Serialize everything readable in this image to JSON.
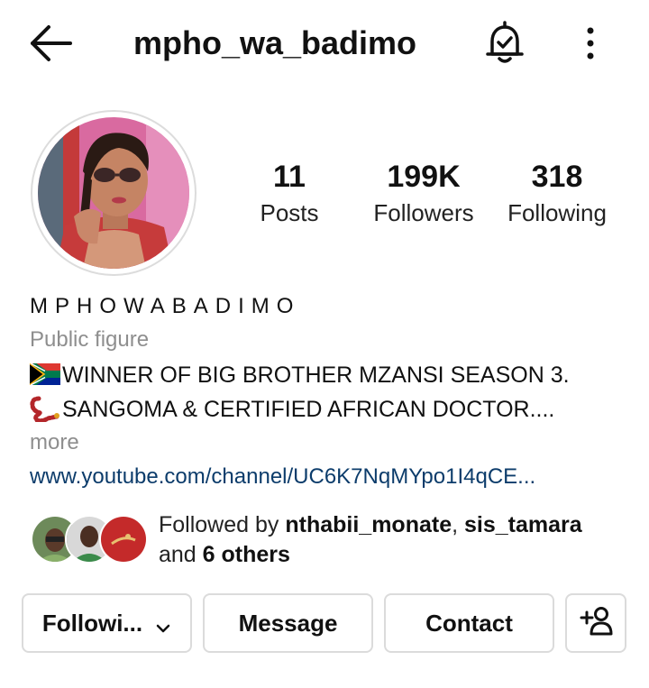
{
  "header": {
    "username": "mpho_wa_badimo",
    "icons": [
      "back-arrow-icon",
      "notification-bell-check-icon",
      "more-vertical-icon"
    ]
  },
  "profile": {
    "avatar_icon": "profile-photo",
    "stats": [
      {
        "value": "11",
        "label": "Posts"
      },
      {
        "value": "199K",
        "label": "Followers"
      },
      {
        "value": "318",
        "label": "Following"
      }
    ],
    "display_name": "MPHOWABADIMO",
    "category": "Public figure",
    "bio_line1": "WINNER OF BIG BROTHER MZANSI SEASON 3.",
    "bio_line2": "SANGOMA & CERTIFIED AFRICAN DOCTOR....",
    "more_label": "more",
    "website": "www.youtube.com/channel/UC6K7NqMYpo1I4qCE..."
  },
  "followed_by": {
    "prefix": "Followed by ",
    "user1": "nthabii_monate",
    "separator": ", ",
    "user2": "sis_tamara",
    "middle": "and ",
    "others": "6 others"
  },
  "actions": {
    "following_label": "Followi...",
    "message_label": "Message",
    "contact_label": "Contact",
    "add_user_icon": "add-person-icon"
  }
}
